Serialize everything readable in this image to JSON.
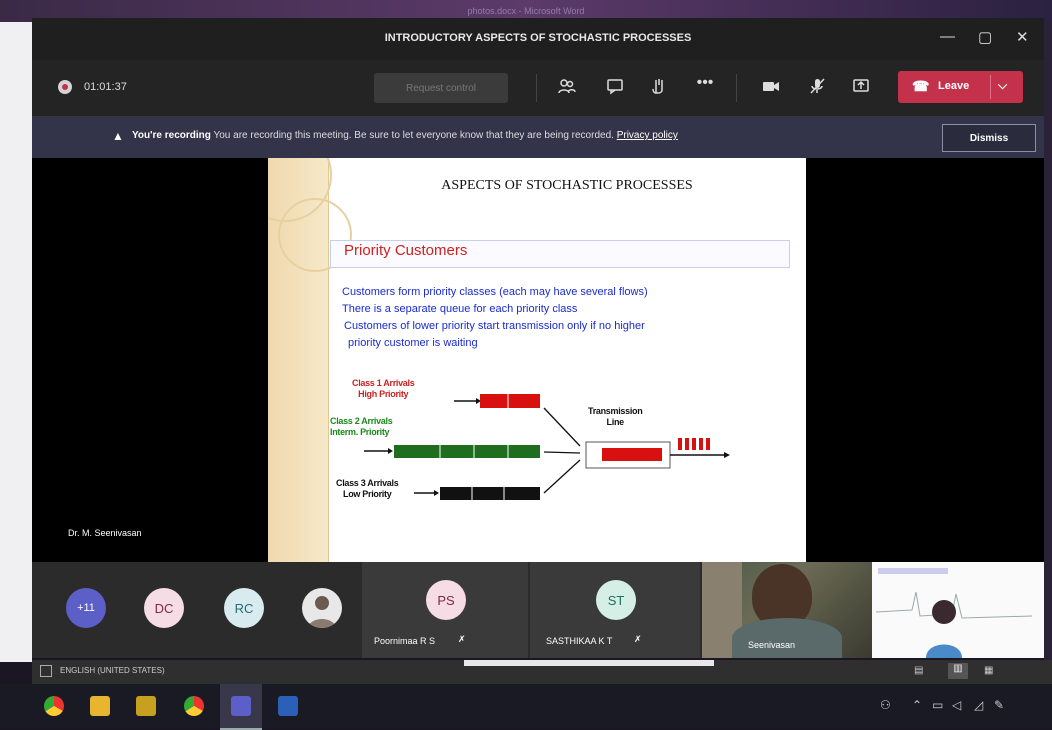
{
  "window": {
    "background_title": "photos.docx - Microsoft Word",
    "meeting_title": "INTRODUCTORY ASPECTS OF STOCHASTIC PROCESSES",
    "minimize": "—",
    "maximize": "▢",
    "close": "✕"
  },
  "toolbar": {
    "timer": "01:01:37",
    "request_control": "Request control",
    "leave": "Leave",
    "icons": [
      "people-icon",
      "chat-icon",
      "raise-hand-icon",
      "more-icon",
      "camera-icon",
      "mic-off-icon",
      "share-icon"
    ]
  },
  "banner": {
    "bold": "You're recording",
    "message": "You are recording this meeting. Be sure to let everyone know that they are being recorded.",
    "link": "Privacy policy",
    "dismiss": "Dismiss"
  },
  "stage": {
    "presenter_label": "Dr. M. Seenivasan"
  },
  "slide": {
    "heading": "ASPECTS OF STOCHASTIC PROCESSES",
    "title": "Priority Customers",
    "bullets": [
      "Customers form priority classes (each may have several flows)",
      "There is a separate  queue for each priority class",
      "Customers of lower priority start transmission only if no higher",
      "priority customer is waiting"
    ],
    "diagram": {
      "class1_a": "Class 1 Arrivals",
      "class1_b": "High Priority",
      "class2_a": "Class 2 Arrivals",
      "class2_b": "Interm. Priority",
      "class3_a": "Class 3 Arrivals",
      "class3_b": "Low Priority",
      "tx_a": "Transmission",
      "tx_b": "Line"
    }
  },
  "participants": {
    "overflow": "+11",
    "avatars": [
      "DC",
      "RC"
    ],
    "tile1": {
      "initials": "PS",
      "name": "Poornimaa R S"
    },
    "tile2": {
      "initials": "ST",
      "name": "SASTHIKAA K T"
    },
    "video1_name": "Seenivasan"
  },
  "statusbar": {
    "language": "ENGLISH (UNITED STATES)"
  },
  "colors": {
    "leave": "#c4314b",
    "banner": "#33344a",
    "slide_title": "#d02020",
    "bullet_text": "#1a2bd0"
  }
}
